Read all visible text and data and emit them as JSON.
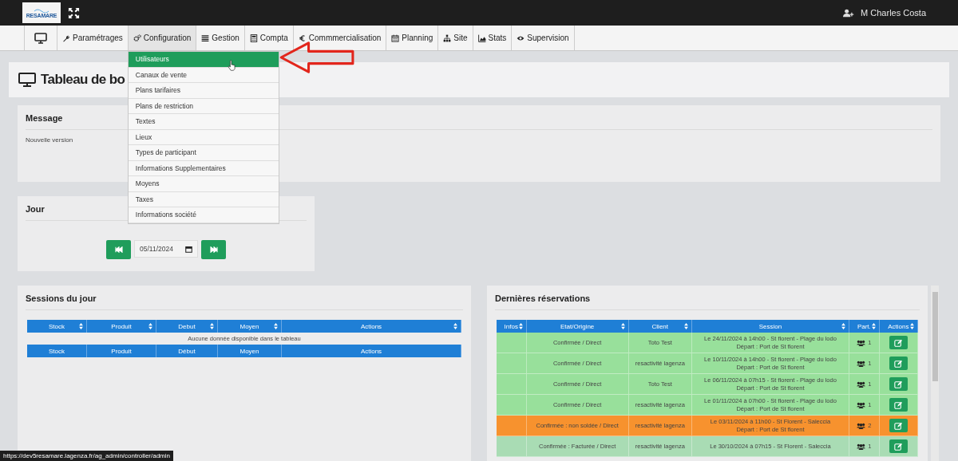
{
  "header": {
    "logo": "RESAMARE",
    "user": "M Charles Costa"
  },
  "nav": [
    {
      "expanded": false
    },
    {
      "label": "Paramétrages",
      "expanded": false
    },
    {
      "label": "Configuration",
      "expanded": true,
      "menu": [
        {
          "label": "Utilisateurs",
          "selected": true
        },
        {
          "label": "Canaux de vente",
          "selected": false
        },
        {
          "label": "Plans tarifaires",
          "selected": false
        },
        {
          "label": "Plans de restriction",
          "selected": false
        },
        {
          "label": "Textes",
          "selected": false
        },
        {
          "label": "Lieux",
          "selected": false
        },
        {
          "label": "Types de participant",
          "selected": false
        },
        {
          "label": "Informations Supplementaires",
          "selected": false
        },
        {
          "label": "Moyens",
          "selected": false
        },
        {
          "label": "Taxes",
          "selected": false
        },
        {
          "label": "Informations société",
          "selected": false
        }
      ]
    },
    {
      "label": "Gestion",
      "expanded": false
    },
    {
      "label": "Compta",
      "expanded": false
    },
    {
      "label": "Commmercialisation",
      "expanded": false
    },
    {
      "label": "Planning",
      "expanded": false
    },
    {
      "label": "Site",
      "expanded": false
    },
    {
      "label": "Stats",
      "expanded": false
    },
    {
      "label": "Supervision",
      "expanded": false
    }
  ],
  "page_title": "Tableau de bo",
  "message_card": {
    "title": "Message",
    "text": "Nouvelle version"
  },
  "day_card": {
    "title": "Jour",
    "date": "05/11/2024"
  },
  "sessions": {
    "title": "Sessions du jour",
    "columns": [
      "Stock",
      "Produit",
      "Debut",
      "Moyen",
      "Actions"
    ],
    "empty_text": "Aucune donnée disponible dans le tableau",
    "footer_columns": [
      "Stock",
      "Produit",
      "Début",
      "Moyen",
      "Actions"
    ]
  },
  "reservations": {
    "title": "Dernières réservations",
    "columns": [
      "Infos",
      "Etat/Origine",
      "Client",
      "Session",
      "Part.",
      "Actions"
    ],
    "rows": [
      {
        "etat": "Confirmée / Direct",
        "client": "Toto Test",
        "session": [
          "Le 24/11/2024 à 14h00 - St florent - Plage du lodo",
          "Départ : Port de St florent"
        ],
        "participants": "1",
        "color": "#98e09b"
      },
      {
        "etat": "Confirmée / Direct",
        "client": "resactivité lagenza",
        "session": [
          "Le 10/11/2024 à 14h00 - St florent - Plage du lodo",
          "Départ : Port de St florent"
        ],
        "participants": "1",
        "color": "#98e09b"
      },
      {
        "etat": "Confirmée / Direct",
        "client": "Toto Test",
        "session": [
          "Le 06/11/2024 à 07h15 - St florent - Plage du lodo",
          "Départ : Port de St florent"
        ],
        "participants": "1",
        "color": "#98e09b"
      },
      {
        "etat": "Confirmée / Direct",
        "client": "resactivité lagenza",
        "session": [
          "Le 01/11/2024 à 07h00 - St florent - Plage du lodo",
          "Départ : Port de St florent"
        ],
        "participants": "1",
        "color": "#98e09b"
      },
      {
        "etat": "Confirmée : non soldée / Direct",
        "client": "resactivité lagenza",
        "session": [
          "Le 03/11/2024 à 11h00 - St Florent - Saleccia",
          "Départ : Port de St florent"
        ],
        "participants": "2",
        "color": "#f7922e"
      },
      {
        "etat": "Confirmée : Facturée / Direct",
        "client": "resactivité lagenza",
        "session": [
          "Le 30/10/2024 à 07h15 - St Florent - Saleccia"
        ],
        "participants": "1",
        "color": "#a9dcb4"
      }
    ]
  },
  "status_bar": {
    "url": "https://dev5resamare.lagenza.fr/ag_admin/controller/admin"
  }
}
